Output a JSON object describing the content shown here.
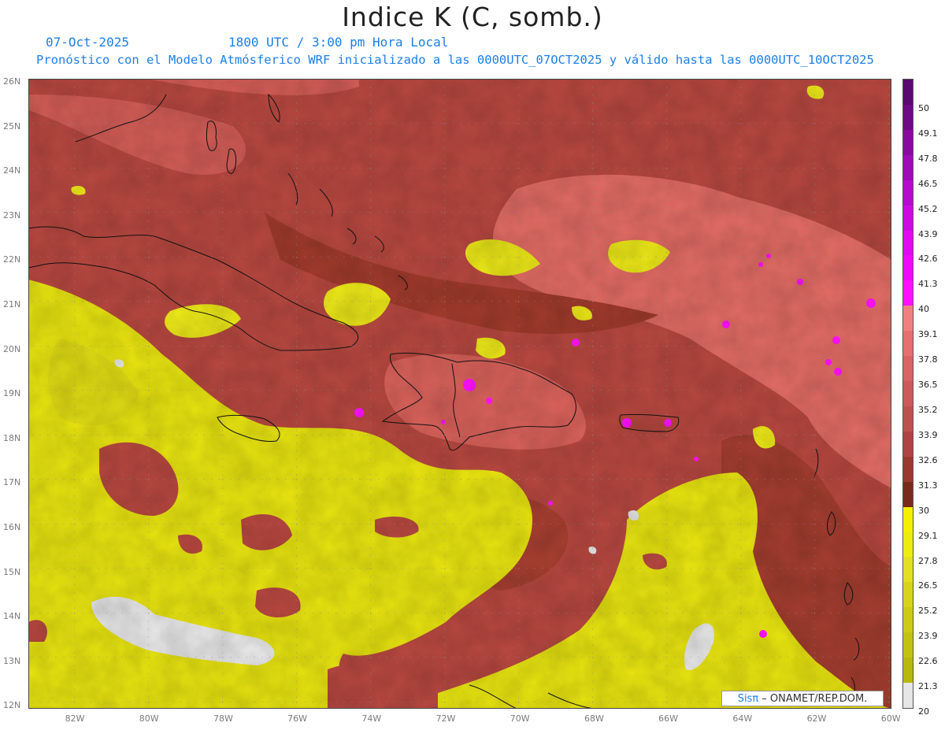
{
  "title": "Indice K (C, somb.)",
  "date": "07-Oct-2025",
  "time": "1800 UTC / 3:00 pm Hora Local",
  "description": "Pronóstico con el Modelo Atmósferico WRF inicializado a las 0000UTC_07OCT2025 y válido hasta las  0000UTC_10OCT2025",
  "lat_labels": [
    "26N",
    "25N",
    "24N",
    "23N",
    "22N",
    "21N",
    "20N",
    "19N",
    "18N",
    "17N",
    "16N",
    "15N",
    "14N",
    "13N",
    "12N"
  ],
  "lon_labels": [
    "82W",
    "80W",
    "78W",
    "76W",
    "74W",
    "72W",
    "70W",
    "68W",
    "66W",
    "64W",
    "62W",
    "60W"
  ],
  "colorbar": {
    "labels": [
      "50",
      "49.1",
      "47.8",
      "46.5",
      "45.2",
      "43.9",
      "42.6",
      "41.3",
      "40",
      "39.1",
      "37.8",
      "36.5",
      "35.2",
      "33.9",
      "32.6",
      "31.3",
      "30",
      "29.1",
      "27.8",
      "26.5",
      "25.2",
      "23.9",
      "22.6",
      "21.3",
      "20"
    ],
    "colors": [
      "#5a0a6e",
      "#6e0a85",
      "#8a0aa0",
      "#a00ab8",
      "#b60ace",
      "#cc0ae0",
      "#e00af0",
      "#f00af8",
      "#ff10ff",
      "#f08080",
      "#e67070",
      "#d86464",
      "#cc5a5a",
      "#be5050",
      "#b04444",
      "#9a3a2e",
      "#7a2a1a",
      "#f4f000",
      "#ecec10",
      "#e2e020",
      "#d6d41a",
      "#cccc14",
      "#c2c210",
      "#b8b80c",
      "#e6e6e6"
    ]
  },
  "credit": {
    "logo": "Sisπ",
    "text": " – ONAMET/REP.DOM."
  }
}
